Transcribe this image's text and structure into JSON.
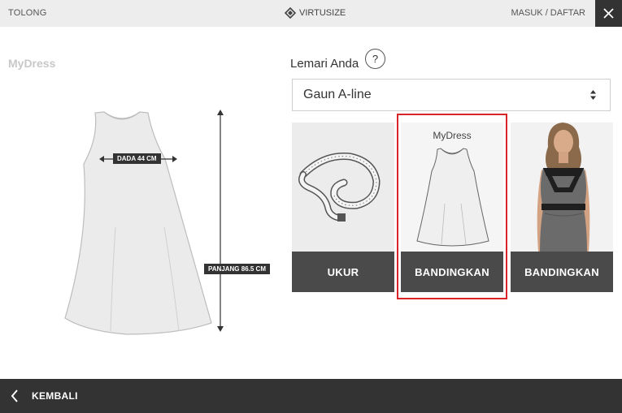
{
  "topbar": {
    "help_label": "TOLONG",
    "brand_label": "VIRTUSIZE",
    "login_label": "MASUK / DAFTAR"
  },
  "item": {
    "title": "MyDress",
    "chest_label": "DADA 44 CM",
    "length_label": "PANJANG 86.5 CM"
  },
  "wardrobe": {
    "title": "Lemari Anda",
    "help_symbol": "?",
    "selected_type": "Gaun A-line"
  },
  "cards": [
    {
      "button_label": "UKUR"
    },
    {
      "caption": "MyDress",
      "button_label": "BANDINGKAN"
    },
    {
      "button_label": "BANDINGKAN"
    }
  ],
  "footer": {
    "back_label": "KEMBALI"
  },
  "colors": {
    "topbar_bg": "#ededed",
    "dark": "#333333",
    "card_button": "#4a4a4a",
    "highlight": "#d9252a"
  }
}
